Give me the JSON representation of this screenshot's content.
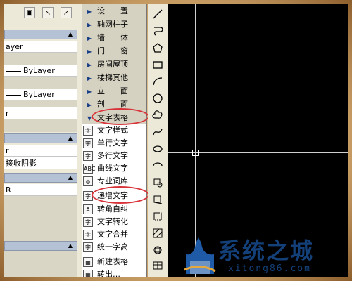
{
  "properties_panel": {
    "rows": [
      "ayer",
      "ByLayer",
      "ByLayer",
      "r",
      "r",
      "接收阴影",
      "R"
    ]
  },
  "menu": {
    "categories_top": [
      "设　　置",
      "轴网柱子",
      "墙　　体",
      "门　　窗",
      "房间屋顶",
      "楼梯其他",
      "立　　面",
      "剖　　面"
    ],
    "open_category": "文字表格",
    "items": [
      {
        "label": "文字样式",
        "icon": "字"
      },
      {
        "label": "单行文字",
        "icon": "字"
      },
      {
        "label": "多行文字",
        "icon": "字"
      },
      {
        "label": "曲线文字",
        "icon": "ABC"
      },
      {
        "label": "专业词库",
        "icon": "◎"
      },
      {
        "label": "递增文字",
        "icon": "字"
      },
      {
        "label": "转角自纠",
        "icon": "A"
      },
      {
        "label": "文字转化",
        "icon": "字"
      },
      {
        "label": "文字合并",
        "icon": "字"
      },
      {
        "label": "统一字高",
        "icon": "字"
      },
      {
        "label": "新建表格",
        "icon": "▦"
      },
      {
        "label": "转出…",
        "icon": "▦"
      }
    ]
  },
  "watermark": {
    "title": "系统之城",
    "url": "xitong86.com"
  },
  "colors": {
    "highlight_oval": "#d9333a",
    "canvas": "#000000",
    "watermark": "#14407a"
  }
}
